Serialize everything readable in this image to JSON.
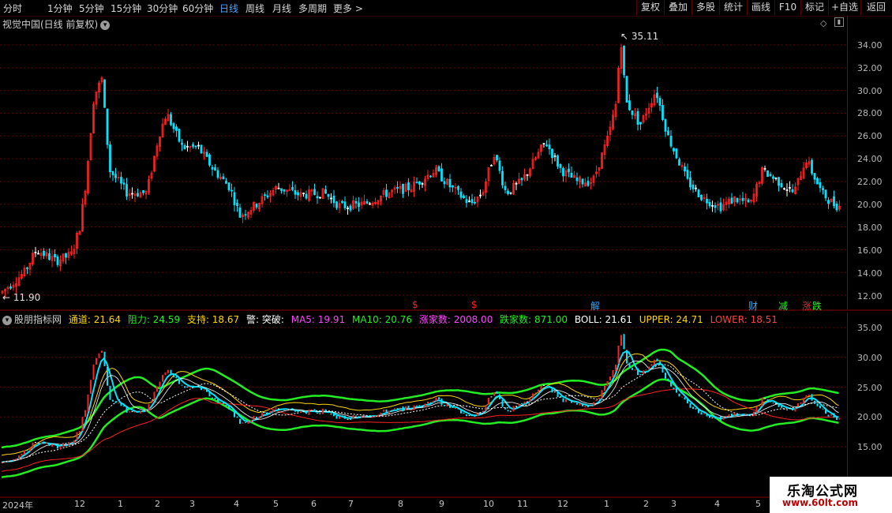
{
  "toolbar": {
    "periods": [
      "分时",
      "1分钟",
      "5分钟",
      "15分钟",
      "30分钟",
      "60分钟",
      "日线",
      "周线",
      "月线",
      "多周期",
      "更多 >"
    ],
    "active_index": 6,
    "buttons": [
      "复权",
      "叠加",
      "多股",
      "统计",
      "画线",
      "F10",
      "标记",
      "+自选",
      "返回"
    ]
  },
  "main_panel": {
    "title": "视觉中国(日线 前复权)",
    "high_label": "35.11",
    "low_label": "11.90",
    "y_ticks": [
      "34.00",
      "32.00",
      "30.00",
      "28.00",
      "26.00",
      "24.00",
      "22.00",
      "20.00",
      "18.00",
      "16.00",
      "14.00",
      "12.00"
    ],
    "markers": [
      {
        "text": "$",
        "color": "#ff2020"
      },
      {
        "text": "$",
        "color": "#ff2020"
      },
      {
        "text": "解",
        "color": "#2fa8ff"
      },
      {
        "text": "财",
        "color": "#2fa8ff"
      },
      {
        "text": "减",
        "color": "#22ee22"
      },
      {
        "text": "涨",
        "color": "#ff2020"
      },
      {
        "text": "跌",
        "color": "#22ee22"
      }
    ]
  },
  "indicator_panel": {
    "name": "股朋指标网",
    "items": [
      {
        "label": "通道: 21.64",
        "color": "#ffd700"
      },
      {
        "label": "阻力: 24.59",
        "color": "#22ee22"
      },
      {
        "label": "支持: 18.67",
        "color": "#ffd700"
      },
      {
        "label": "警: 突破:",
        "color": "#ffffff"
      },
      {
        "label": "MA5: 19.91",
        "color": "#ff44ff"
      },
      {
        "label": "MA10: 20.76",
        "color": "#22ee22"
      },
      {
        "label": "涨家数: 2008.00",
        "color": "#ff44ff"
      },
      {
        "label": "跌家数: 871.00",
        "color": "#22ee22"
      },
      {
        "label": "BOLL: 21.61",
        "color": "#ffffff"
      },
      {
        "label": "UPPER: 24.71",
        "color": "#ffd700"
      },
      {
        "label": "LOWER: 18.51",
        "color": "#ff4040"
      }
    ],
    "y_ticks": [
      "35.00",
      "30.00",
      "25.00",
      "20.00",
      "15.00"
    ]
  },
  "x_axis": [
    "2024年",
    "12",
    "1",
    "2",
    "3",
    "4",
    "5",
    "6",
    "7",
    "8",
    "9",
    "10",
    "11",
    "12",
    "1",
    "2",
    "3",
    "4",
    "5"
  ],
  "watermark": {
    "line1": "乐淘公式网",
    "line2": "www.60lt.com"
  },
  "colors": {
    "up": "#ff2020",
    "down": "#00e5ff",
    "flat": "#ffffff",
    "grid": "#6a0000",
    "axis": "#8a0000",
    "channel": "#22ee22",
    "resist": "#ffd700"
  }
}
